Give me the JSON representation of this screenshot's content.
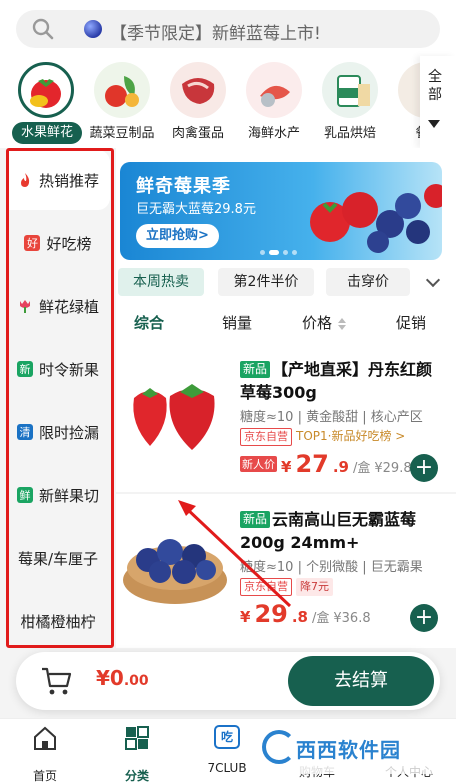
{
  "search": {
    "placeholder": "【季节限定】新鲜蓝莓上市!"
  },
  "categories": [
    {
      "label": "水果鲜花",
      "active": true
    },
    {
      "label": "蔬菜豆制品"
    },
    {
      "label": "肉禽蛋品"
    },
    {
      "label": "海鲜水产"
    },
    {
      "label": "乳品烘焙"
    },
    {
      "label": "餐"
    }
  ],
  "all_label": "全部",
  "sidebar": [
    {
      "label": "热销推荐",
      "icon": "flame-icon",
      "active": true
    },
    {
      "label": "好吃榜",
      "icon": "好"
    },
    {
      "label": "鲜花绿植",
      "icon": "tulip-icon"
    },
    {
      "label": "时令新果",
      "icon": "新"
    },
    {
      "label": "限时捡漏",
      "icon": "清"
    },
    {
      "label": "新鲜果切",
      "icon": "鲜"
    },
    {
      "label": "莓果/车厘子"
    },
    {
      "label": "柑橘橙柚柠"
    }
  ],
  "banner": {
    "title": "鲜奇莓果季",
    "subtitle": "巨无霸大蓝莓29.8元",
    "button": "立即抢购>"
  },
  "chips": [
    "本周热卖",
    "第2件半价",
    "击穿价"
  ],
  "sort": [
    "综合",
    "销量",
    "价格",
    "促销"
  ],
  "products": [
    {
      "new_tag": "新品",
      "title": "【产地直采】丹东红颜草莓300g",
      "sub": "糖度≈10 | 黄金酸甜 | 核心产区",
      "tag1": "京东自营",
      "rank": "TOP1·新品好吃榜 >",
      "price_badge": "新人价",
      "currency": "¥",
      "price_int": "27",
      "price_dec": ".9",
      "unit": "/盒",
      "old": "¥29.8"
    },
    {
      "new_tag": "新品",
      "title": "云南高山巨无霸蓝莓200g 24mm+",
      "sub": "糖度≈10 | 个别微酸 | 巨无霸果",
      "tag1": "京东自营",
      "tag2": "降7元",
      "currency": "¥",
      "price_int": "29",
      "price_dec": ".8",
      "unit": "/盒",
      "old": "¥36.8"
    }
  ],
  "cart": {
    "currency": "¥",
    "amount": "0",
    "decimals": ".00",
    "checkout": "去结算"
  },
  "tabs": [
    "首页",
    "分类",
    "7CLUB",
    "购物车",
    "个人中心"
  ],
  "club_badge": "吃",
  "watermark": "西西软件园",
  "colors": {
    "brand_green": "#17604f",
    "price_red": "#e23a2a",
    "annotation_red": "#e11b1b"
  }
}
